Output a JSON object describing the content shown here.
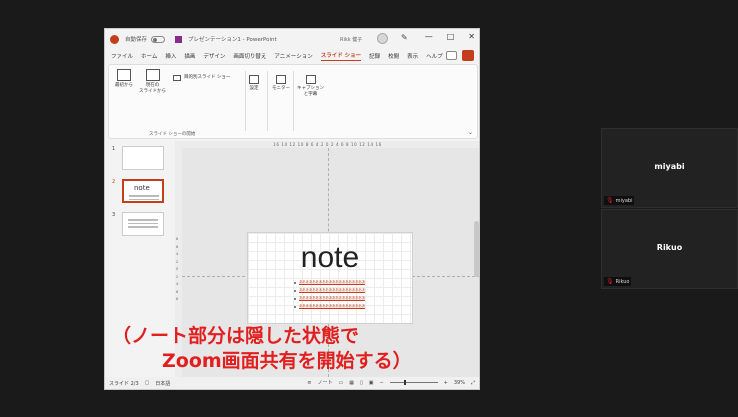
{
  "ppt": {
    "titlebar": {
      "autosave_label": "自動保存",
      "doc_title": "プレゼンテーション1 - PowerPoint",
      "search_text": "Rikk 健子",
      "window_minimize": "—",
      "window_maximize": "□",
      "window_close": "✕"
    },
    "tabs": [
      "ファイル",
      "ホーム",
      "挿入",
      "描画",
      "デザイン",
      "画面切り替え",
      "アニメーション",
      "スライド ショー",
      "記録",
      "校閲",
      "表示",
      "ヘルプ"
    ],
    "active_tab": "スライド ショー",
    "ribbon": {
      "from_start": "最初から",
      "from_current": "現在の\nスライドから",
      "custom_show": "目的別スライド ショー",
      "group_label": "スライド ショーの開始",
      "setup": "設定",
      "monitor": "モニター",
      "captions": "キャプション\nと字幕"
    },
    "thumbnails": [
      {
        "num": "1",
        "text": ""
      },
      {
        "num": "2",
        "text": "note"
      },
      {
        "num": "3",
        "text": ""
      }
    ],
    "ruler_top": "16 14 12 10 8 6 4 2 0 2 4 6 8 10 12 14 16",
    "ruler_left": "8\n6\n4\n2\n0\n2\n4\n6\n8",
    "slide": {
      "title": "note",
      "bullets": [
        "ああああああああああああああああああああ",
        "ああああああああああああああああああああ",
        "ああああああああああああああああああああ",
        "ああああああああああああああああああああ"
      ]
    },
    "status": {
      "slide_counter": "スライド 2/3",
      "language": "日本語",
      "notes_label": "ノート",
      "zoom": "39%"
    }
  },
  "caption": {
    "line1": "（ノート部分は隠した状態で",
    "line2": "Zoom画面共有を開始する）"
  },
  "participants": [
    {
      "name": "miyabi",
      "tag": "miyabi"
    },
    {
      "name": "Rikuo",
      "tag": "Rikuo"
    }
  ],
  "colors": {
    "accent": "#c43e1c",
    "caption": "#e11f1f",
    "background": "#1a1a1a"
  }
}
